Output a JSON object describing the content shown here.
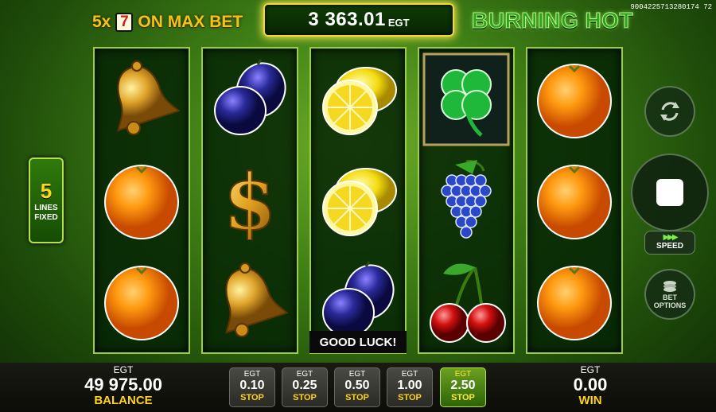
{
  "header": {
    "promo_multiplier": "5x",
    "promo_symbol": "7",
    "promo_text": "ON MAX BET",
    "jackpot_amount": "3 363.01",
    "jackpot_currency": "EGT",
    "logo": "BURNING HOT",
    "game_id": "9004225713280174 72"
  },
  "lines_panel": {
    "count": "5",
    "label_1": "LINES",
    "label_2": "FIXED"
  },
  "reels": [
    [
      "bell",
      "orange",
      "orange"
    ],
    [
      "plum",
      "dollar",
      "bell"
    ],
    [
      "lemon",
      "lemon",
      "plum"
    ],
    [
      "clover",
      "grapes",
      "cherries"
    ],
    [
      "orange",
      "orange",
      "orange"
    ]
  ],
  "message": "GOOD LUCK!",
  "controls": {
    "speed_label": "SPEED",
    "bet_options_1": "BET",
    "bet_options_2": "OPTIONS"
  },
  "balance": {
    "currency": "EGT",
    "value": "49 975.00",
    "label": "BALANCE"
  },
  "win": {
    "currency": "EGT",
    "value": "0.00",
    "label": "WIN"
  },
  "bets": [
    {
      "currency": "EGT",
      "amount": "0.10",
      "label": "STOP",
      "selected": false
    },
    {
      "currency": "EGT",
      "amount": "0.25",
      "label": "STOP",
      "selected": false
    },
    {
      "currency": "EGT",
      "amount": "0.50",
      "label": "STOP",
      "selected": false
    },
    {
      "currency": "EGT",
      "amount": "1.00",
      "label": "STOP",
      "selected": false
    },
    {
      "currency": "EGT",
      "amount": "2.50",
      "label": "STOP",
      "selected": true
    }
  ],
  "colors": {
    "accent": "#f6c21a",
    "frame": "#9ccf3e",
    "logo": "#2ea21c"
  }
}
